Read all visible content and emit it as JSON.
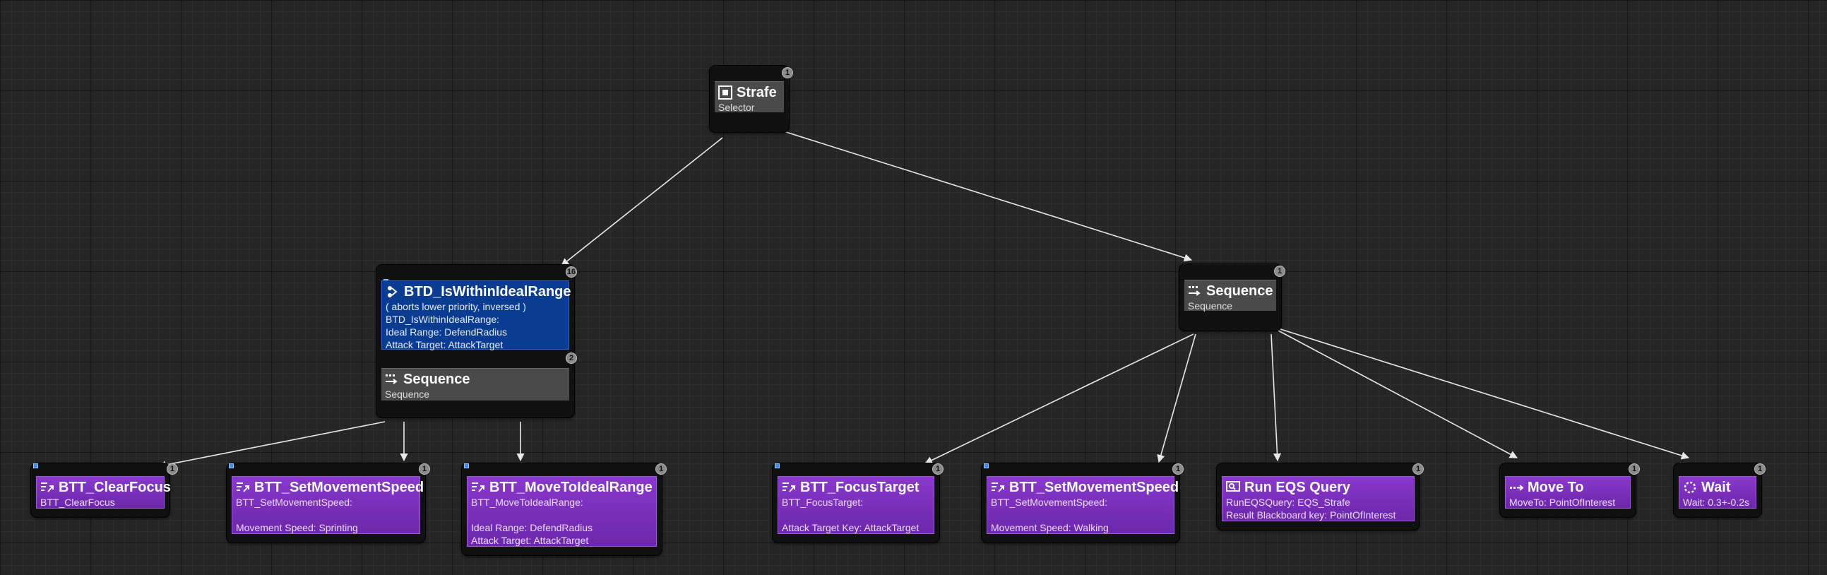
{
  "wire_color": "#e8e8e8",
  "nodes": {
    "strafe": {
      "title": "Strafe",
      "subtitle": "Selector",
      "icon": "selector-icon",
      "badge": "1"
    },
    "range": {
      "decorator_title": "BTD_IsWithinIdealRange",
      "decorator_badge": "16",
      "decorator_lines": [
        "( aborts lower priority, inversed )",
        "BTD_IsWithinIdealRange:",
        "",
        "Ideal Range: DefendRadius",
        "Attack Target: AttackTarget"
      ],
      "decorator_icon": "decorator-icon",
      "title": "Sequence",
      "subtitle": "Sequence",
      "icon": "sequence-icon",
      "badge": "2"
    },
    "seq_right": {
      "title": "Sequence",
      "subtitle": "Sequence",
      "icon": "sequence-icon",
      "badge": "1"
    },
    "clear_focus": {
      "title": "BTT_ClearFocus",
      "subtitle": "BTT_ClearFocus",
      "icon": "task-icon",
      "badge": "1"
    },
    "set_speed_sprint": {
      "title": "BTT_SetMovementSpeed",
      "subtitle": "BTT_SetMovementSpeed:\n\nMovement Speed: Sprinting",
      "icon": "task-icon",
      "badge": "1"
    },
    "move_ideal": {
      "title": "BTT_MoveToIdealRange",
      "subtitle": "BTT_MoveToIdealRange:\n\nIdeal Range: DefendRadius\nAttack Target: AttackTarget",
      "icon": "task-icon",
      "badge": "1"
    },
    "focus_target": {
      "title": "BTT_FocusTarget",
      "subtitle": "BTT_FocusTarget:\n\nAttack Target Key: AttackTarget",
      "icon": "task-icon",
      "badge": "1"
    },
    "set_speed_walk": {
      "title": "BTT_SetMovementSpeed",
      "subtitle": "BTT_SetMovementSpeed:\n\nMovement Speed: Walking",
      "icon": "task-icon",
      "badge": "1"
    },
    "eqs": {
      "title": "Run EQS Query",
      "subtitle": "RunEQSQuery: EQS_Strafe\nResult Blackboard key: PointOfInterest",
      "icon": "eqs-icon",
      "badge": "1"
    },
    "move_to": {
      "title": "Move To",
      "subtitle": "MoveTo: PointOfInterest",
      "icon": "move-to-icon",
      "badge": "1"
    },
    "wait": {
      "title": "Wait",
      "subtitle": "Wait: 0.3+-0.2s",
      "icon": "wait-icon",
      "badge": "1"
    }
  }
}
